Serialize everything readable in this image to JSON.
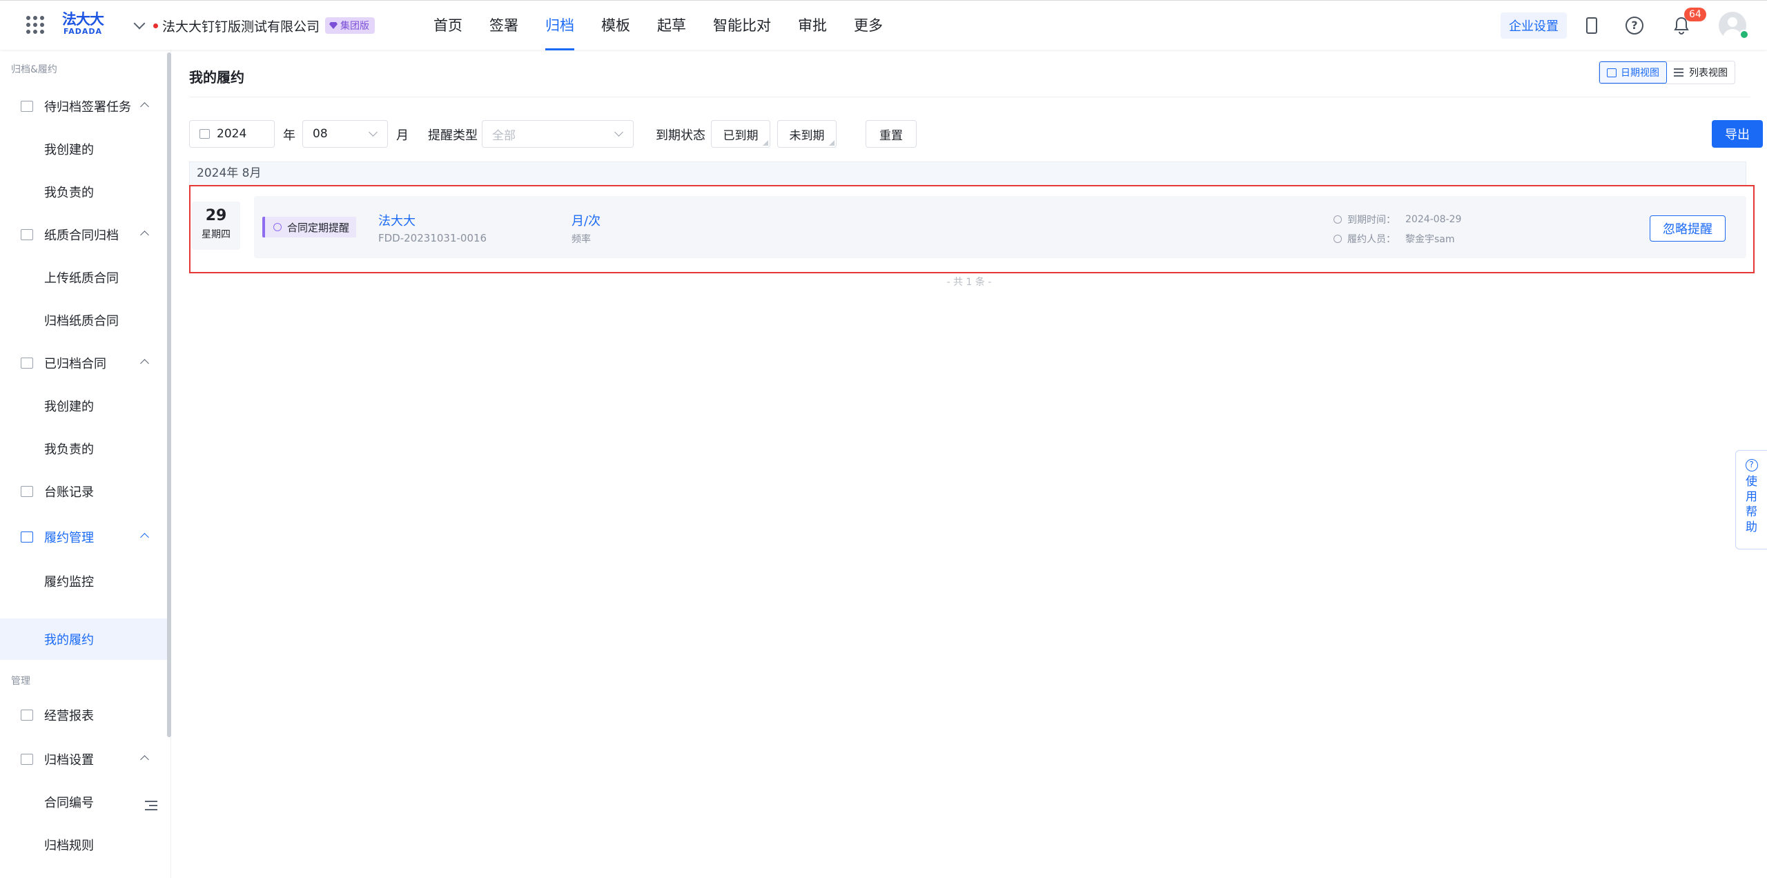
{
  "topbar": {
    "logo_cn": "法大大",
    "logo_en": "FADADA",
    "company_name": "法大大钉钉版测试有限公司",
    "company_badge": "集团版",
    "nav": [
      "首页",
      "签署",
      "归档",
      "模板",
      "起草",
      "智能比对",
      "审批",
      "更多"
    ],
    "nav_active_index": 2,
    "enterprise_settings": "企业设置",
    "notification_count": "64"
  },
  "sidebar": {
    "section1_title": "归档&履约",
    "section2_title": "管理",
    "items": [
      {
        "label": "待归档签署任务",
        "level": "parent",
        "icon": "folder-icon"
      },
      {
        "label": "我创建的",
        "level": "child"
      },
      {
        "label": "我负责的",
        "level": "child"
      },
      {
        "label": "纸质合同归档",
        "level": "parent",
        "icon": "document-icon"
      },
      {
        "label": "上传纸质合同",
        "level": "child"
      },
      {
        "label": "归档纸质合同",
        "level": "child"
      },
      {
        "label": "已归档合同",
        "level": "parent",
        "icon": "archive-box-icon"
      },
      {
        "label": "我创建的",
        "level": "child"
      },
      {
        "label": "我负责的",
        "level": "child"
      },
      {
        "label": "台账记录",
        "level": "parent",
        "icon": "ledger-icon"
      },
      {
        "label": "履约管理",
        "level": "parent",
        "icon": "edit-icon"
      },
      {
        "label": "履约监控",
        "level": "child"
      },
      {
        "label": "我的履约",
        "level": "child",
        "selected": true
      },
      {
        "label": "经营报表",
        "level": "parent",
        "icon": "bar-chart-icon"
      },
      {
        "label": "归档设置",
        "level": "parent",
        "icon": "folder-settings-icon"
      },
      {
        "label": "合同编号",
        "level": "child"
      },
      {
        "label": "归档规则",
        "level": "child"
      }
    ]
  },
  "main": {
    "title": "我的履约",
    "view_date": "日期视图",
    "view_list": "列表视图",
    "filters": {
      "year": "2024",
      "year_suffix": "年",
      "month": "08",
      "month_suffix": "月",
      "reminder_type_label": "提醒类型",
      "reminder_type_placeholder": "全部",
      "due_status_label": "到期状态",
      "due_reached": "已到期",
      "due_not_reached": "未到期",
      "reset": "重置",
      "export": "导出"
    },
    "month_header": "2024年 8月",
    "record": {
      "day": "29",
      "weekday": "星期四",
      "type_tag": "合同定期提醒",
      "party": "法大大",
      "contract_no": "FDD-20231031-0016",
      "frequency_value": "月/次",
      "frequency_label": "频率",
      "due_time_label": "到期时间：",
      "due_time_value": "2024-08-29",
      "performer_label": "履约人员：",
      "performer_value": "黎金宇sam",
      "ignore_button": "忽略提醒"
    },
    "total": "- 共 1 条 -"
  },
  "help_tab": "使用帮助",
  "colors": {
    "primary": "#1b6af5",
    "badge_purple": "#7b4fd6",
    "highlight_red": "#e53935",
    "notification_red": "#f5533d"
  }
}
